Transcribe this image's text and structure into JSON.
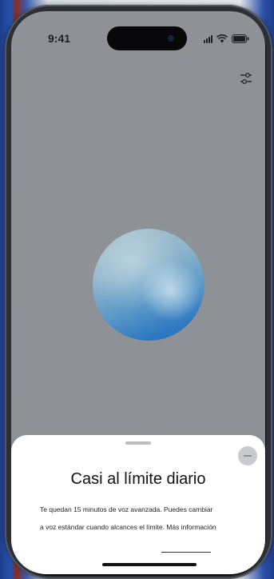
{
  "status_bar": {
    "time": "9:41",
    "icons": [
      "signal-icon",
      "wifi-icon",
      "battery-icon"
    ]
  },
  "toolbar": {
    "settings_icon": "sliders-icon"
  },
  "voice_orb": {
    "colors": [
      "#a8c0cc",
      "#5f9cc8",
      "#2a6fb8"
    ]
  },
  "sheet": {
    "title": "Casi al límite diario",
    "body_line1": "Te quedan 15 minutos de voz avanzada. Puedes cambiar",
    "body_line2_prefix": "a voz estándar cuando alcances el límite.",
    "more_link": "Más información",
    "close_icon": "minus-icon"
  },
  "colors": {
    "screen_dim": "#8e9195",
    "sheet_bg": "#ffffff",
    "text": "#111111"
  }
}
